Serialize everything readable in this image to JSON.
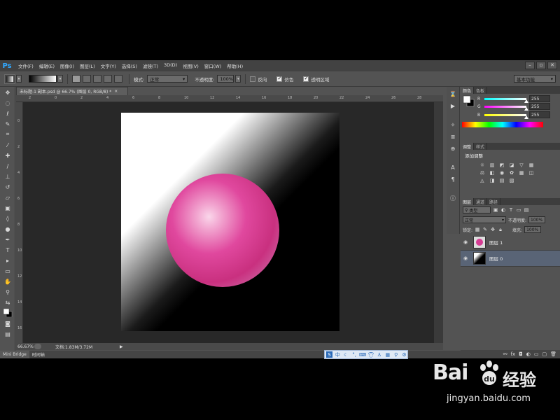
{
  "app": {
    "logo": "Ps",
    "menu": [
      "文件(F)",
      "编辑(E)",
      "图像(I)",
      "图层(L)",
      "文字(Y)",
      "选择(S)",
      "滤镜(T)",
      "3D(D)",
      "视图(V)",
      "窗口(W)",
      "帮助(H)"
    ],
    "window_controls": [
      "–",
      "▫",
      "✕"
    ]
  },
  "options_bar": {
    "mode_label": "模式:",
    "mode_value": "正常",
    "opacity_label": "不透明度:",
    "opacity_value": "100%",
    "reverse_label": "反向",
    "dither_label": "仿色",
    "transparency_label": "透明区域",
    "workspace_value": "基本功能"
  },
  "document": {
    "tab_title": "未标题-1 副本.psd @ 66.7% (图层 0, RGB/8) *",
    "tab_close": "×",
    "zoom": "66.67%",
    "info": "文档:1.83M/3.72M",
    "ruler_top": [
      "2",
      "0",
      "2",
      "4",
      "6",
      "8",
      "10",
      "12",
      "14",
      "16",
      "18",
      "20",
      "22",
      "24",
      "26",
      "28",
      "30"
    ],
    "ruler_left": [
      "0",
      "2",
      "4",
      "6",
      "8",
      "10",
      "12",
      "14",
      "16",
      "18",
      "20"
    ]
  },
  "bottom_tabs": [
    "Mini Bridge",
    "时间轴"
  ],
  "color_panel": {
    "tabs": [
      "颜色",
      "色板"
    ],
    "channels": [
      {
        "name": "R",
        "value": "255",
        "fraction": 1.0
      },
      {
        "name": "G",
        "value": "255",
        "fraction": 1.0
      },
      {
        "name": "B",
        "value": "255",
        "fraction": 1.0
      }
    ]
  },
  "adjust_panel": {
    "tabs": [
      "调整",
      "样式"
    ],
    "title": "添加调整"
  },
  "layers_panel": {
    "tabs": [
      "图层",
      "通道",
      "路径"
    ],
    "filter_label": "类型",
    "blend_value": "正常",
    "opacity_label": "不透明度:",
    "opacity_value": "100%",
    "lock_label": "锁定:",
    "fill_label": "填充:",
    "fill_value": "100%",
    "layers": [
      {
        "name": "图层 1",
        "selected": false
      },
      {
        "name": "图层 0",
        "selected": true
      }
    ]
  },
  "ime": {
    "mode": "中"
  },
  "watermark": {
    "logo": "Bai",
    "logo_suffix": "经验",
    "url": "jingyan.baidu.com"
  },
  "colors": {
    "accent": "#31a8ff",
    "sphere": "#d63c93",
    "sphere_highlight": "#f6c6e2",
    "selected_layer": "#596476"
  }
}
